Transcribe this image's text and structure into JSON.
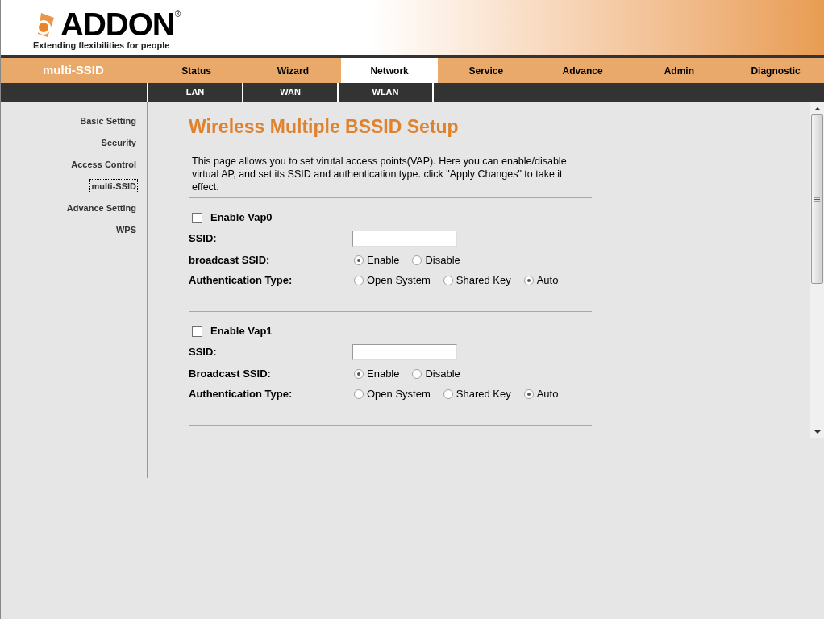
{
  "logo": {
    "name": "ADDON",
    "mark": "®",
    "tagline": "Extending flexibilities for people"
  },
  "nav": {
    "section": "multi-SSID",
    "tabs": [
      {
        "label": "Status",
        "selected": false
      },
      {
        "label": "Wizard",
        "selected": false
      },
      {
        "label": "Network",
        "selected": true
      },
      {
        "label": "Service",
        "selected": false
      },
      {
        "label": "Advance",
        "selected": false
      },
      {
        "label": "Admin",
        "selected": false
      },
      {
        "label": "Diagnostic",
        "selected": false
      }
    ],
    "subtabs": [
      {
        "label": "LAN",
        "selected": false
      },
      {
        "label": "WAN",
        "selected": false
      },
      {
        "label": "WLAN",
        "selected": false
      }
    ]
  },
  "sidebar": {
    "items": [
      {
        "label": "Basic Setting",
        "selected": false
      },
      {
        "label": "Security",
        "selected": false
      },
      {
        "label": "Access Control",
        "selected": false
      },
      {
        "label": "multi-SSID",
        "selected": true
      },
      {
        "label": "Advance Setting",
        "selected": false
      },
      {
        "label": "WPS",
        "selected": false
      }
    ]
  },
  "page": {
    "title": "Wireless Multiple BSSID Setup",
    "description": "This page allows you to set virutal access points(VAP). Here you can enable/disable virtual AP, and set its SSID and authentication type. click \"Apply Changes\" to take it effect.",
    "vaps": [
      {
        "enable_label": "Enable Vap0",
        "enabled": false,
        "ssid_label": "SSID:",
        "broadcast_label": "broadcast SSID:",
        "broadcast_options": [
          {
            "label": "Enable",
            "selected": true
          },
          {
            "label": "Disable",
            "selected": false
          }
        ],
        "auth_label": "Authentication Type:",
        "auth_options": [
          {
            "label": "Open System",
            "selected": false
          },
          {
            "label": "Shared Key",
            "selected": false
          },
          {
            "label": "Auto",
            "selected": true
          }
        ]
      },
      {
        "enable_label": "Enable Vap1",
        "enabled": false,
        "ssid_label": "SSID:",
        "broadcast_label": "Broadcast SSID:",
        "broadcast_options": [
          {
            "label": "Enable",
            "selected": true
          },
          {
            "label": "Disable",
            "selected": false
          }
        ],
        "auth_label": "Authentication Type:",
        "auth_options": [
          {
            "label": "Open System",
            "selected": false
          },
          {
            "label": "Shared Key",
            "selected": false
          },
          {
            "label": "Auto",
            "selected": true
          }
        ]
      }
    ]
  }
}
